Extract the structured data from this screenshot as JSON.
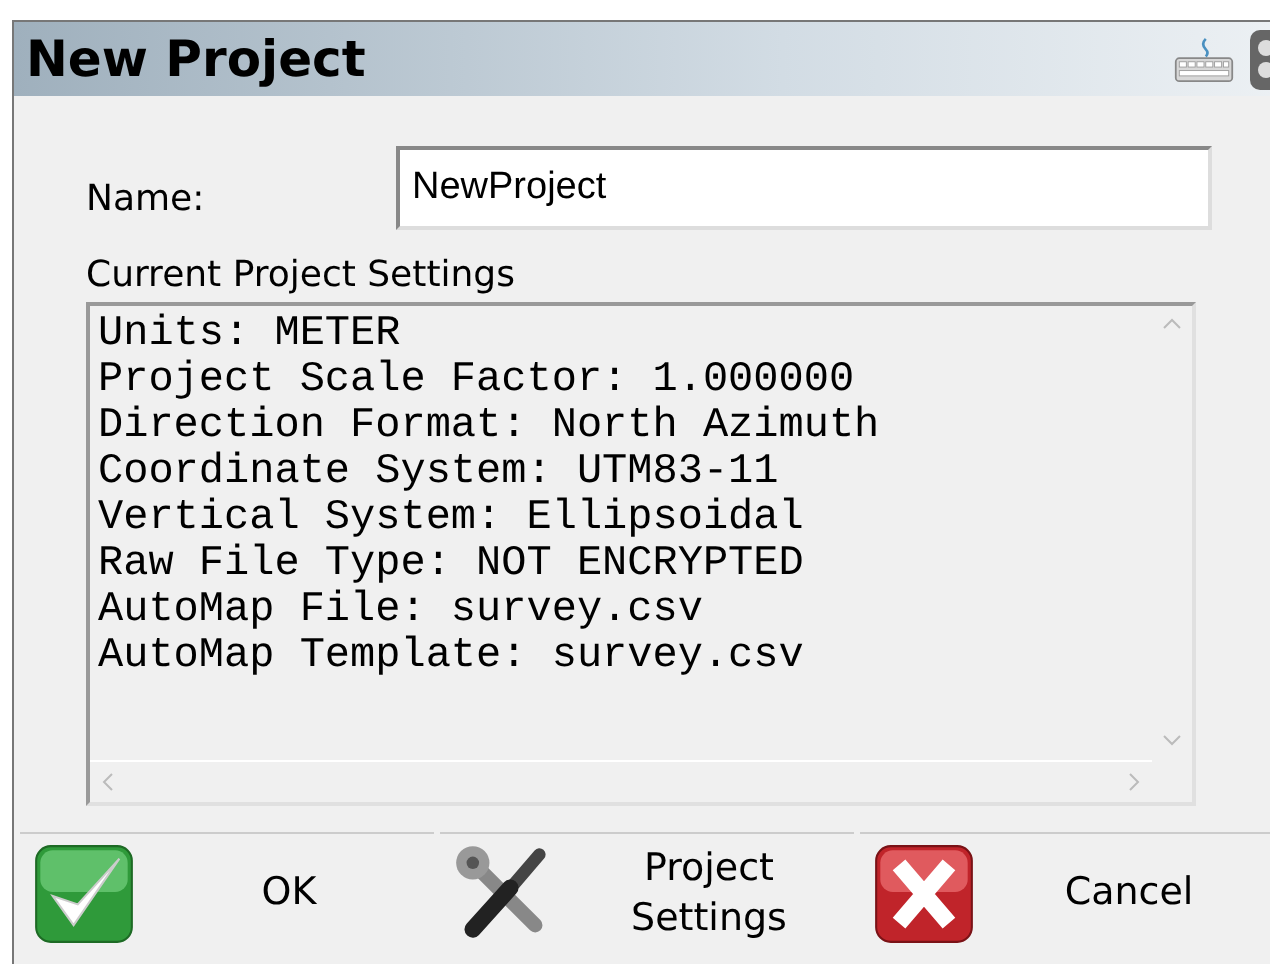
{
  "window": {
    "title": "New Project"
  },
  "name_field": {
    "label": "Name:",
    "value": "NewProject"
  },
  "settings": {
    "heading": "Current Project Settings",
    "lines": [
      "Units: METER",
      "Project Scale Factor: 1.000000",
      "Direction Format: North Azimuth",
      "Coordinate System: UTM83-11",
      "Vertical System: Ellipsoidal",
      "Raw File Type: NOT ENCRYPTED",
      "AutoMap File: survey.csv",
      "AutoMap Template: survey.csv"
    ]
  },
  "buttons": [
    {
      "kind": "ok",
      "label": "OK"
    },
    {
      "kind": "settings",
      "label": "Project Settings"
    },
    {
      "kind": "cancel",
      "label": "Cancel"
    }
  ]
}
